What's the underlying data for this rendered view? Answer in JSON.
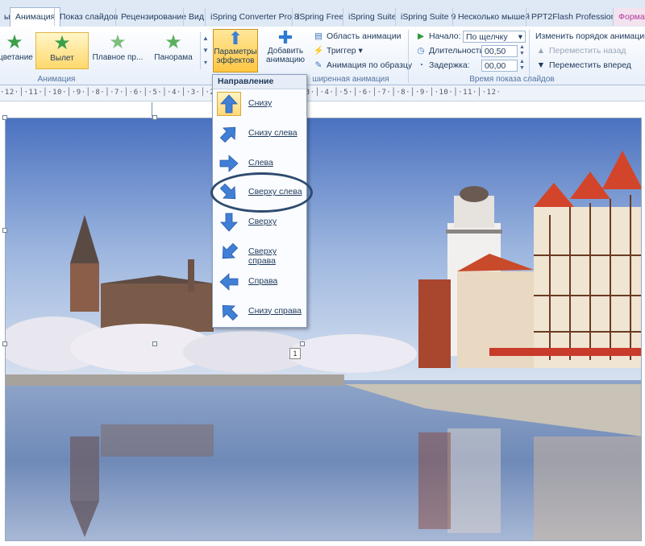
{
  "tabs": [
    {
      "label": "ы"
    },
    {
      "label": "Анимация",
      "active": true
    },
    {
      "label": "Показ слайдов"
    },
    {
      "label": "Рецензирование"
    },
    {
      "label": "Вид"
    },
    {
      "label": "iSpring Converter Pro 8"
    },
    {
      "label": "iSpring Free"
    },
    {
      "label": "iSpring Suite"
    },
    {
      "label": "iSpring Suite 9"
    },
    {
      "label": "Несколько мышей"
    },
    {
      "label": "PPT2Flash Professional"
    },
    {
      "label": "Формат"
    }
  ],
  "ribbon": {
    "animations": [
      {
        "label": "цветание"
      },
      {
        "label": "Вылет",
        "selected": true
      },
      {
        "label": "Плавное пр..."
      },
      {
        "label": "Панорама"
      }
    ],
    "effect_options": {
      "line1": "Параметры",
      "line2": "эффектов"
    },
    "add_animation": {
      "line1": "Добавить",
      "line2": "анимацию"
    },
    "advanced": {
      "pane": "Область анимации",
      "trigger": "Триггер",
      "painter": "Анимация по образцу"
    },
    "timing": {
      "start_label": "Начало:",
      "start_value": "По щелчку",
      "duration_label": "Длительность:",
      "duration_value": "00,50",
      "delay_label": "Задержка:",
      "delay_value": "00,00"
    },
    "reorder": {
      "title": "Изменить порядок анимации",
      "back": "Переместить назад",
      "forward": "Переместить вперед"
    },
    "groups": {
      "animation": "Анимация",
      "advanced": "ширенная анимация",
      "timing": "Время показа слайдов"
    }
  },
  "ruler": {
    "text": "·12·│·11·│·10·│·9·│·8·│·7·│·6·│·5·│·4·│·3·│·2·│·1·│·0·│·1·│·2·│·3·│·4·│·5·│·6·│·7·│·8·│·9·│·10·│·11·│·12·"
  },
  "slide": {
    "badge": "1"
  },
  "dropdown": {
    "header": "Направление",
    "items": [
      {
        "label": "Снизу",
        "arrow": "up",
        "selected": true
      },
      {
        "label": "Снизу слева",
        "arrow": "up-right"
      },
      {
        "label": "Слева",
        "arrow": "right"
      },
      {
        "label": "Сверху слева",
        "arrow": "down-right"
      },
      {
        "label": "Сверху",
        "arrow": "down"
      },
      {
        "label": "Сверху справа",
        "arrow": "down-left"
      },
      {
        "label": "Справа",
        "arrow": "left"
      },
      {
        "label": "Снизу справа",
        "arrow": "up-left"
      }
    ]
  },
  "colors": {
    "arrow": "#3f7fd6",
    "highlight": "#2e4b6f",
    "selected": "#ffd86b"
  }
}
